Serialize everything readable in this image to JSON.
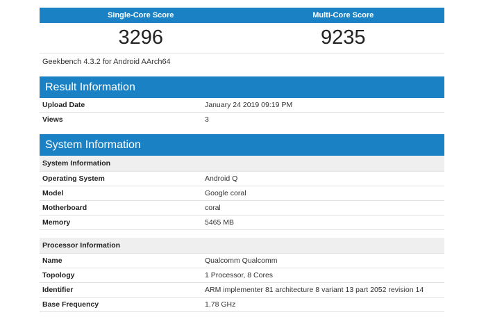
{
  "scores": {
    "single_label": "Single-Core Score",
    "multi_label": "Multi-Core Score",
    "single_value": "3296",
    "multi_value": "9235",
    "version": "Geekbench 4.3.2 for Android AArch64"
  },
  "result": {
    "title": "Result Information",
    "rows": [
      {
        "k": "Upload Date",
        "v": "January 24 2019 09:19 PM"
      },
      {
        "k": "Views",
        "v": "3"
      }
    ]
  },
  "system": {
    "title": "System Information",
    "sys_sub": "System Information",
    "sys_rows": [
      {
        "k": "Operating System",
        "v": "Android Q"
      },
      {
        "k": "Model",
        "v": "Google coral"
      },
      {
        "k": "Motherboard",
        "v": "coral"
      },
      {
        "k": "Memory",
        "v": "5465 MB"
      }
    ],
    "proc_sub": "Processor Information",
    "proc_rows": [
      {
        "k": "Name",
        "v": "Qualcomm Qualcomm"
      },
      {
        "k": "Topology",
        "v": "1 Processor, 8 Cores"
      },
      {
        "k": "Identifier",
        "v": "ARM implementer 81 architecture 8 variant 13 part 2052 revision 14"
      },
      {
        "k": "Base Frequency",
        "v": "1.78 GHz"
      }
    ]
  }
}
